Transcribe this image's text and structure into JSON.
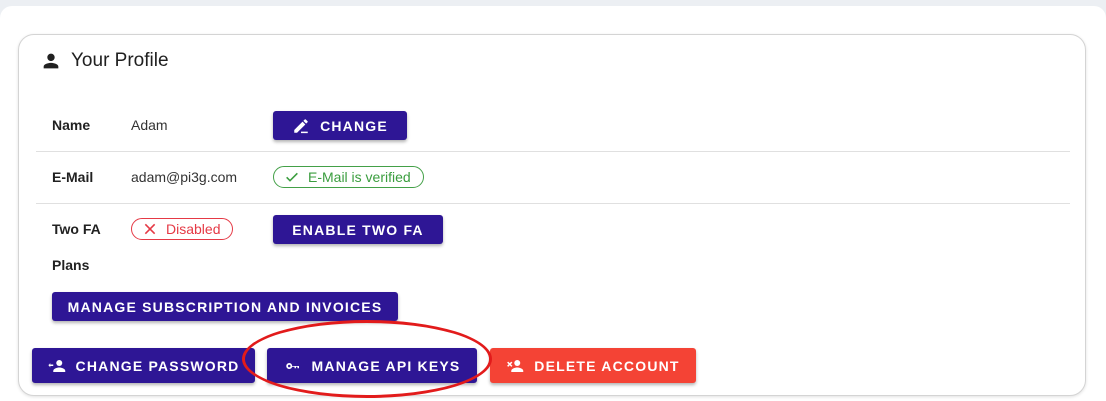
{
  "profile": {
    "title": "Your Profile",
    "title_icon": "person-icon",
    "rows": {
      "name": {
        "label": "Name",
        "value": "Adam",
        "button_label": "CHANGE"
      },
      "email": {
        "label": "E-Mail",
        "value": "adam@pi3g.com",
        "status": "E-Mail is verified"
      },
      "two_fa": {
        "label": "Two FA",
        "status": "Disabled",
        "button_label": "ENABLE TWO FA"
      },
      "plans": {
        "label": "Plans",
        "button_label": "MANAGE SUBSCRIPTION AND INVOICES"
      }
    },
    "actions": {
      "change_password": "CHANGE PASSWORD",
      "manage_api_keys": "MANAGE API KEYS",
      "delete_account": "DELETE ACCOUNT"
    }
  },
  "colors": {
    "primary": "#2e1695",
    "danger": "#f44335",
    "success": "#43a047",
    "error": "#e53945",
    "highlight": "#e21b1b"
  }
}
